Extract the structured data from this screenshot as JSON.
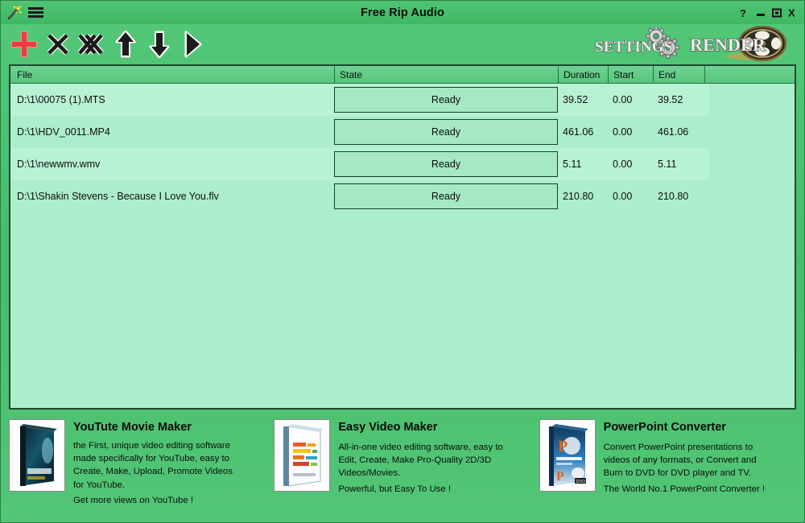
{
  "window": {
    "title": "Free Rip Audio",
    "logo_icon": "magic-wand-icon",
    "menu_icon": "hamburger-menu-icon",
    "controls": [
      {
        "name": "help-button",
        "icon": "question-mark-icon",
        "label": "?"
      },
      {
        "name": "minimize-button",
        "icon": "minimize-icon",
        "label": "–"
      },
      {
        "name": "maximize-button",
        "icon": "maximize-icon",
        "label": "□"
      },
      {
        "name": "close-button",
        "icon": "close-x-icon",
        "label": "X"
      }
    ]
  },
  "toolbar": {
    "buttons": [
      {
        "name": "add-file-button",
        "icon": "plus-icon",
        "tip": "Add"
      },
      {
        "name": "remove-file-button",
        "icon": "x-icon",
        "tip": "Remove"
      },
      {
        "name": "remove-all-button",
        "icon": "double-x-icon",
        "tip": "Remove All"
      },
      {
        "name": "move-up-button",
        "icon": "arrow-up-icon",
        "tip": "Move Up"
      },
      {
        "name": "move-down-button",
        "icon": "arrow-down-icon",
        "tip": "Move Down"
      },
      {
        "name": "play-button",
        "icon": "play-triangle-icon",
        "tip": "Play"
      }
    ],
    "settings_label": "SETTINGS",
    "settings_icon": "gears-icon",
    "render_label": "RENDER",
    "render_icon": "film-reel-icon"
  },
  "filelist": {
    "columns": [
      "File",
      "State",
      "Duration",
      "Start",
      "End"
    ],
    "rows": [
      {
        "file": "D:\\1\\00075 (1).MTS",
        "state": "Ready",
        "duration": "39.52",
        "start": "0.00",
        "end": "39.52"
      },
      {
        "file": "D:\\1\\HDV_0011.MP4",
        "state": "Ready",
        "duration": "461.06",
        "start": "0.00",
        "end": "461.06"
      },
      {
        "file": "D:\\1\\newwmv.wmv",
        "state": "Ready",
        "duration": "5.11",
        "start": "0.00",
        "end": "5.11"
      },
      {
        "file": "D:\\1\\Shakin Stevens - Because I Love You.flv",
        "state": "Ready",
        "duration": "210.80",
        "start": "0.00",
        "end": "210.80"
      }
    ]
  },
  "promos": [
    {
      "title": "YouTute Movie Maker",
      "thumb_icon": "software-box-youtube-icon",
      "desc": "the First, unique video editing software\nmade specifically for YouTube, easy to\nCreate, Make, Upload, Promote Videos\nfor YouTube.",
      "foot": "Get more views on YouTube !"
    },
    {
      "title": "Easy Video Maker",
      "thumb_icon": "software-box-easyvideo-icon",
      "desc": "All-in-one video editing software, easy to\nEdit, Create, Make Pro-Quality 2D/3D\nVideos/Movies.",
      "foot": "Powerful, but Easy To Use !"
    },
    {
      "title": "PowerPoint Converter",
      "thumb_icon": "software-box-pptconverter-icon",
      "desc": "Convert PowerPoint presentations to\nvideos of any formats, or Convert and\nBurn to DVD for DVD player and TV.",
      "foot": "The World No.1 PowerPoint Converter !"
    }
  ],
  "colors": {
    "window_green": "#4ec16e",
    "list_light_row": "#b8f2d4",
    "list_base_row": "#aceecb",
    "header_green": "#62cc87",
    "border_dark": "#1c4a30",
    "add_icon_red": "#f0484a"
  }
}
